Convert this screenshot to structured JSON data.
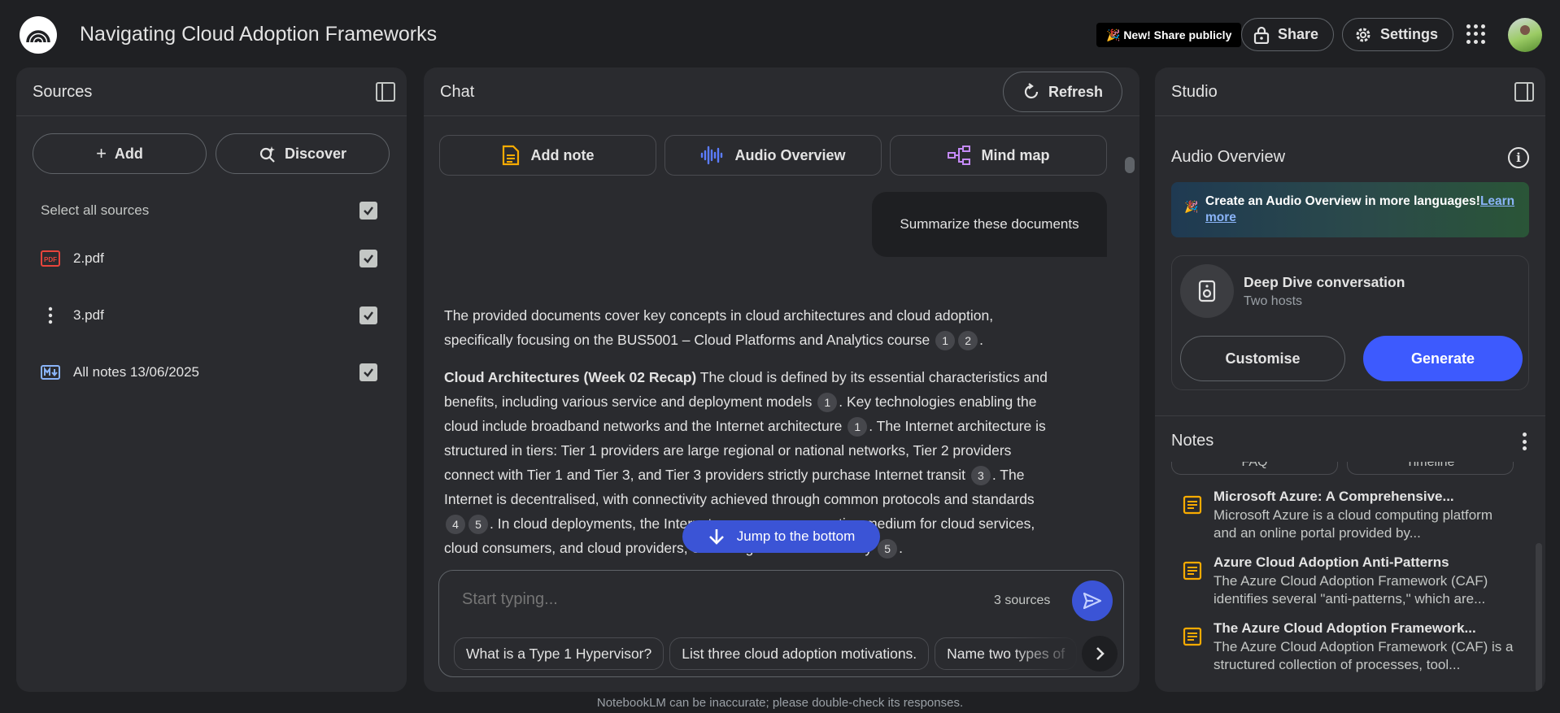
{
  "header": {
    "title": "Navigating Cloud Adoption Frameworks",
    "new_badge": "🎉 New! Share publicly",
    "share_label": "Share",
    "settings_label": "Settings"
  },
  "sources": {
    "title": "Sources",
    "add_label": "Add",
    "discover_label": "Discover",
    "select_all_label": "Select all sources",
    "items": [
      {
        "name": "2.pdf",
        "icon": "pdf-icon",
        "checked": true
      },
      {
        "name": "3.pdf",
        "icon": "more-vert-icon",
        "checked": true
      },
      {
        "name": "All notes 13/06/2025",
        "icon": "markdown-icon",
        "checked": true
      }
    ]
  },
  "chat": {
    "title": "Chat",
    "refresh_label": "Refresh",
    "actions": {
      "add_note": "Add note",
      "audio_overview": "Audio Overview",
      "mind_map": "Mind map"
    },
    "user_message": "Summarize these documents",
    "answer": {
      "p1_text": "The provided documents cover key concepts in cloud architectures and cloud adoption, specifically focusing on the BUS5001 – Cloud Platforms and Analytics course",
      "p1_cites": [
        "1",
        "2"
      ],
      "p2_heading": "Cloud Architectures (Week 02 Recap)",
      "p2_a": "The cloud is defined by its essential characteristics and benefits, including various service and deployment models",
      "p2_cite_a": "1",
      "p2_b": ". Key technologies enabling the cloud include broadband networks and the Internet architecture",
      "p2_cite_b": "1",
      "p2_c": ". The Internet architecture is structured in tiers: Tier 1 providers are large regional or national networks, Tier 2 providers connect with Tier 1 and Tier 3, and Tier 3 providers strictly purchase Internet transit",
      "p2_cite_c": "3",
      "p2_d": ". The Internet is decentralised, with connectivity achieved through common protocols and standards",
      "p2_cite_d1": "4",
      "p2_cite_d2": "5",
      "p2_e": ". In cloud deployments, the Internet serves as a connecting medium for cloud services, cloud consumers, and cloud providers, extending the trust boundary",
      "p2_cite_e": "5"
    },
    "jump_label": "Jump to the bottom",
    "input_placeholder": "Start typing...",
    "sources_count": "3 sources",
    "suggestions": [
      "What is a Type 1 Hypervisor?",
      "List three cloud adoption motivations.",
      "Name two types of"
    ]
  },
  "studio": {
    "title": "Studio",
    "audio_overview_title": "Audio Overview",
    "promo_text": "Create an Audio Overview in more languages!",
    "promo_link": "Learn more",
    "deep_dive_title": "Deep Dive conversation",
    "deep_dive_sub": "Two hosts",
    "customise_label": "Customise",
    "generate_label": "Generate",
    "notes_title": "Notes",
    "note_chips": [
      "FAQ",
      "Timeline"
    ],
    "notes": [
      {
        "title": "Microsoft Azure: A Comprehensive...",
        "body": "Microsoft Azure is a cloud computing platform and an online portal provided by..."
      },
      {
        "title": "Azure Cloud Adoption Anti-Patterns",
        "body": "The Azure Cloud Adoption Framework (CAF) identifies several \"anti-patterns,\" which are..."
      },
      {
        "title": "The Azure Cloud Adoption Framework...",
        "body": "The Azure Cloud Adoption Framework (CAF) is a structured collection of processes, tool..."
      }
    ]
  },
  "footer": {
    "disclaimer": "NotebookLM can be inaccurate; please double-check its responses."
  },
  "colors": {
    "background": "#1f2023",
    "panel": "#2a2b2f",
    "accent_blue": "#3d5afe",
    "note_icon": "#f9ab00",
    "pdf_red": "#e8453c"
  }
}
